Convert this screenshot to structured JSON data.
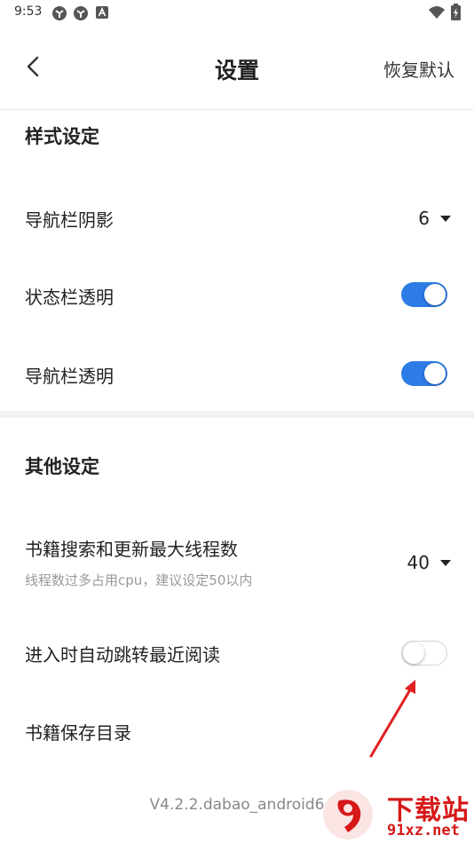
{
  "status_bar": {
    "time": "9:53",
    "icons": [
      "notification-app-icon",
      "notification-app-icon",
      "a-badge-icon",
      "wifi-icon",
      "battery-charging-icon"
    ]
  },
  "header": {
    "back_icon": "chevron-left-icon",
    "title": "设置",
    "restore_label": "恢复默认"
  },
  "style_section": {
    "title": "样式设定",
    "nav_shadow": {
      "label": "导航栏阴影",
      "value": "6"
    },
    "status_transparent": {
      "label": "状态栏透明",
      "on": true
    },
    "nav_transparent": {
      "label": "导航栏透明",
      "on": true
    }
  },
  "other_section": {
    "title": "其他设定",
    "max_threads": {
      "label": "书籍搜索和更新最大线程数",
      "sub": "线程数过多占用cpu，建议设定50以内",
      "value": "40"
    },
    "auto_jump": {
      "label": "进入时自动跳转最近阅读",
      "on": false
    },
    "save_dir": {
      "label": "书籍保存目录"
    }
  },
  "version": "V4.2.2.dabao_android6",
  "watermark": {
    "brand": "下载站",
    "site": "91xz.net"
  },
  "colors": {
    "accent": "#2d7be5",
    "annotation_arrow": "#e02020",
    "watermark": "#d61818"
  }
}
